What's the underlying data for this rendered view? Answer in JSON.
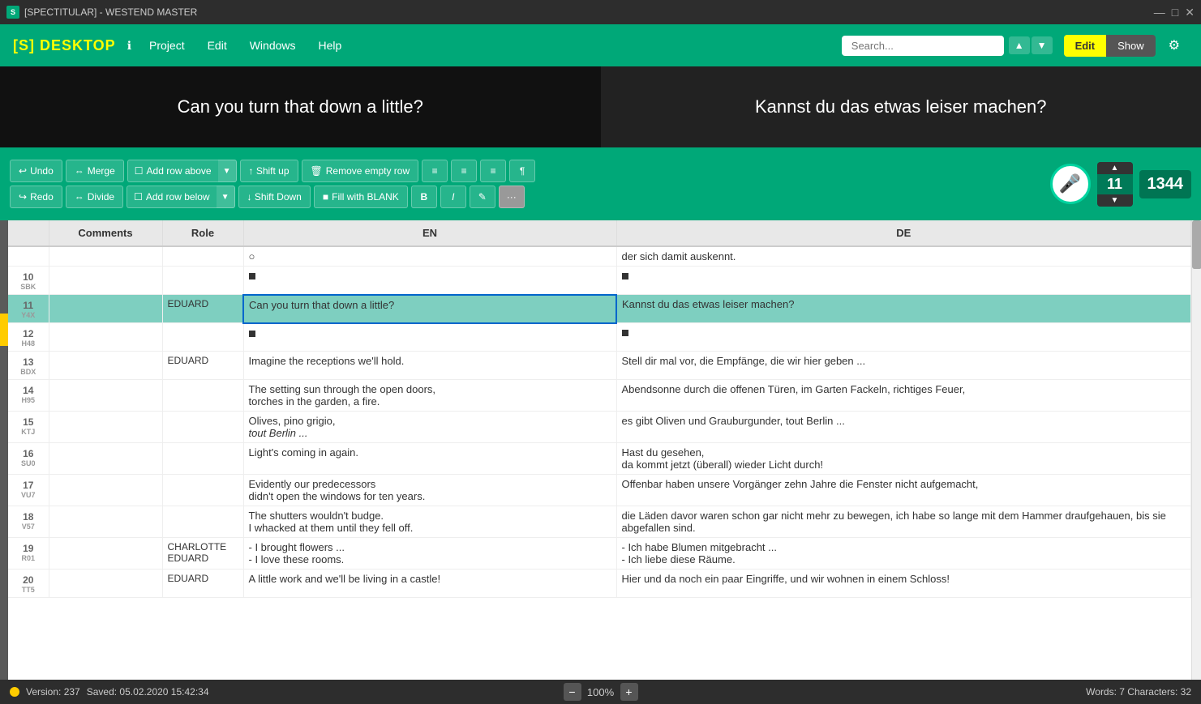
{
  "titlebar": {
    "app_icon": "S",
    "title": "[SPECTITULAR] - WESTEND MASTER",
    "minimize": "—",
    "maximize": "□",
    "close": "✕"
  },
  "navbar": {
    "brand": "[S] DESKTOP",
    "info_label": "ℹ",
    "project_label": "Project",
    "edit_label": "Edit",
    "windows_label": "Windows",
    "help_label": "Help",
    "search_placeholder": "Search...",
    "edit_btn": "Edit",
    "show_btn": "Show"
  },
  "preview": {
    "en_text": "Can you turn that down a little?",
    "de_text": "Kannst du das etwas leiser machen?"
  },
  "toolbar": {
    "undo_label": "Undo",
    "redo_label": "Redo",
    "merge_label": "Merge",
    "divide_label": "Divide",
    "add_row_above_label": "Add row above",
    "add_row_below_label": "Add row below",
    "shift_up_label": "↑ Shift up",
    "shift_down_label": "↓ Shift Down",
    "remove_empty_row_label": "Remove empty row",
    "fill_with_blank_label": "Fill with BLANK",
    "counter_value": "11",
    "total_value": "1344"
  },
  "table": {
    "columns": [
      "Comments",
      "Role",
      "EN",
      "DE"
    ],
    "rows": [
      {
        "num": "",
        "code": "",
        "comments": "",
        "role": "",
        "en": "○",
        "de": "der sich damit auskennt.",
        "selected": false
      },
      {
        "num": "10",
        "code": "SBK",
        "comments": "",
        "role": "",
        "en": "■",
        "de": "■",
        "selected": false,
        "small_square": true
      },
      {
        "num": "11",
        "code": "Y4X",
        "comments": "",
        "role": "EDUARD",
        "en": "Can you turn that down a little?",
        "de": "Kannst du das etwas leiser machen?",
        "selected": true
      },
      {
        "num": "12",
        "code": "H48",
        "comments": "",
        "role": "",
        "en": "■",
        "de": "■",
        "selected": false,
        "small_square": true
      },
      {
        "num": "13",
        "code": "BDX",
        "comments": "",
        "role": "EDUARD",
        "en": "Imagine the receptions we'll hold.",
        "de": "Stell dir mal vor, die Empfänge, die wir hier geben ...",
        "selected": false
      },
      {
        "num": "14",
        "code": "H95",
        "comments": "",
        "role": "",
        "en": "The setting sun through the open doors,\ntorches in the garden, a fire.",
        "de": "Abendsonne durch die offenen Türen, im Garten Fackeln, richtiges Feuer,",
        "selected": false
      },
      {
        "num": "15",
        "code": "KTJ",
        "comments": "",
        "role": "",
        "en": "Olives, pino grigio,\ntout Berlin ...",
        "de": "es gibt Oliven und Grauburgunder, tout Berlin ...",
        "selected": false,
        "italic_en": true
      },
      {
        "num": "16",
        "code": "SU0",
        "comments": "",
        "role": "",
        "en": "Light's coming in again.",
        "de": "Hast du gesehen,\nda kommt jetzt (überall) wieder Licht durch!",
        "selected": false
      },
      {
        "num": "17",
        "code": "VU7",
        "comments": "",
        "role": "",
        "en": "Evidently our predecessors\ndidn't open the windows for ten years.",
        "de": "Offenbar haben unsere Vorgänger zehn Jahre die Fenster nicht aufgemacht,",
        "selected": false
      },
      {
        "num": "18",
        "code": "V57",
        "comments": "",
        "role": "",
        "en": "The shutters wouldn't budge.\nI whacked at them until they fell off.",
        "de": "die Läden davor waren schon gar nicht mehr zu bewegen, ich habe so lange mit dem Hammer draufgehauen, bis sie abgefallen sind.",
        "selected": false
      },
      {
        "num": "19",
        "code": "R01",
        "comments": "",
        "role": "CHARLOTTE\nEDUARD",
        "en": "- I brought flowers ...\n- I love these rooms.",
        "de": "- Ich habe Blumen mitgebracht ...\n- Ich liebe diese Räume.",
        "selected": false
      },
      {
        "num": "20",
        "code": "TT5",
        "comments": "",
        "role": "EDUARD",
        "en": "A little work and we'll be living in a castle!",
        "de": "Hier und da noch ein paar Eingriffe, und wir wohnen in einem Schloss!",
        "selected": false
      }
    ]
  },
  "statusbar": {
    "version": "Version: 237",
    "saved": "Saved: 05.02.2020 15:42:34",
    "zoom": "100%",
    "word_count": "Words: 7 Characters: 32"
  }
}
